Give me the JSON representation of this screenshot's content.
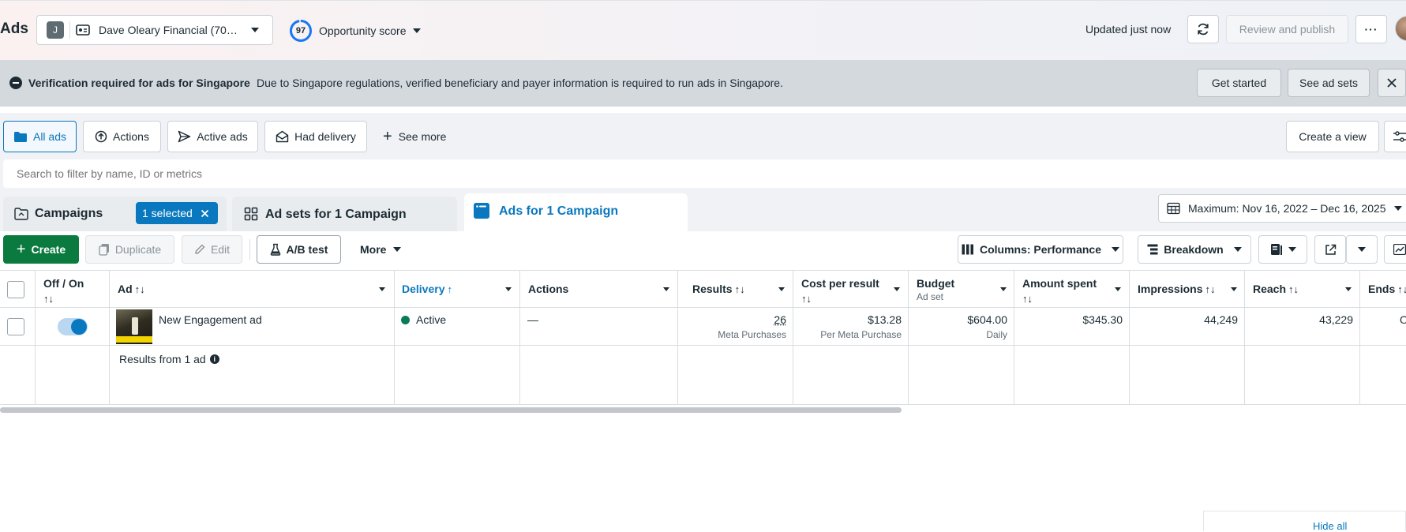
{
  "topbar": {
    "title": "Ads",
    "account_initial": "J",
    "account_name": "Dave Oleary Financial (70…",
    "opportunity_score": "97",
    "opportunity_label": "Opportunity score",
    "updated": "Updated just now",
    "review_publish": "Review and publish"
  },
  "banner": {
    "title": "Verification required for ads for Singapore",
    "message": "Due to Singapore regulations, verified beneficiary and payer information is required to run ads in Singapore.",
    "get_started": "Get started",
    "see_ad_sets": "See ad sets"
  },
  "views": {
    "all_ads": "All ads",
    "actions": "Actions",
    "active_ads": "Active ads",
    "had_delivery": "Had delivery",
    "see_more": "See more",
    "create_view": "Create a view"
  },
  "search": {
    "placeholder": "Search to filter by name, ID or metrics"
  },
  "tabs": {
    "campaigns": "Campaigns",
    "selected_chip": "1 selected",
    "ad_sets": "Ad sets for 1 Campaign",
    "ads": "Ads for 1 Campaign",
    "date_range": "Maximum: Nov 16, 2022 – Dec 16, 2025"
  },
  "toolbar": {
    "create": "Create",
    "duplicate": "Duplicate",
    "edit": "Edit",
    "ab_test": "A/B test",
    "more": "More",
    "columns": "Columns: Performance",
    "breakdown": "Breakdown"
  },
  "table": {
    "headers": {
      "off_on": "Off / On",
      "ad": "Ad",
      "delivery": "Delivery",
      "actions": "Actions",
      "results": "Results",
      "cost_per_result": "Cost per result",
      "budget": "Budget",
      "budget_sub": "Ad set",
      "amount_spent": "Amount spent",
      "impressions": "Impressions",
      "reach": "Reach",
      "ends": "Ends"
    },
    "row": {
      "ad_name": "New Engagement ad",
      "delivery": "Active",
      "actions": "—",
      "results": "26",
      "results_sub": "Meta Purchases",
      "cost_per_result": "$13.28",
      "cost_sub": "Per Meta Purchase",
      "budget": "$604.00",
      "budget_sub": "Daily",
      "amount_spent": "$345.30",
      "impressions": "44,249",
      "reach": "43,229",
      "ends_partial": "O",
      "toggle_on": true
    },
    "summary": "Results from 1 ad"
  },
  "footer": {
    "hide_all": "Hide all"
  },
  "colors": {
    "accent_blue": "#0a78be",
    "create_green": "#0a7a3e",
    "banner_bg": "#d4d9de",
    "active_dot": "#0a7a5a"
  }
}
